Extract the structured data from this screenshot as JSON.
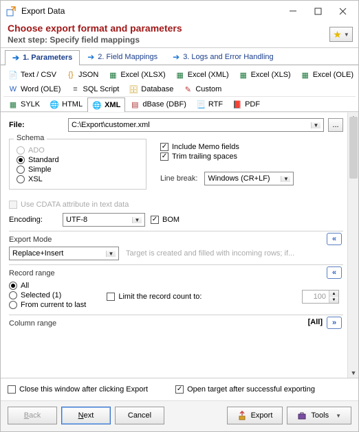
{
  "window": {
    "title": "Export Data"
  },
  "header": {
    "heading": "Choose export format and parameters",
    "sub": "Next step: Specify field mappings"
  },
  "wizard_tabs": {
    "t1": "1. Parameters",
    "t2": "2. Field Mappings",
    "t3": "3. Logs and Error Handling"
  },
  "formats": {
    "text": "Text / CSV",
    "json": "JSON",
    "xlsx": "Excel (XLSX)",
    "xml_xl": "Excel (XML)",
    "xls": "Excel (XLS)",
    "ole_xl": "Excel (OLE)",
    "word": "Word (OLE)",
    "sql": "SQL Script",
    "db": "Database",
    "custom": "Custom",
    "sylk": "SYLK",
    "html": "HTML",
    "xml": "XML",
    "dbase": "dBase (DBF)",
    "rtf": "RTF",
    "pdf": "PDF"
  },
  "file": {
    "label": "File:",
    "value": "C:\\Export\\customer.xml",
    "dots": "..."
  },
  "schema": {
    "legend": "Schema",
    "ado": "ADO",
    "standard": "Standard",
    "simple": "Simple",
    "xsl": "XSL"
  },
  "right": {
    "memo": "Include Memo fields",
    "trim": "Trim trailing spaces",
    "lb_label": "Line break:",
    "lb_value": "Windows (CR+LF)"
  },
  "cdata": "Use CDATA attribute in text data",
  "encoding": {
    "label": "Encoding:",
    "value": "UTF-8",
    "bom": "BOM"
  },
  "export_mode": {
    "title": "Export Mode",
    "value": "Replace+Insert",
    "desc": "Target is created and filled with incoming rows; if..."
  },
  "record_range": {
    "title": "Record range",
    "all": "All",
    "selected": "Selected (1)",
    "current": "From current to last",
    "limit_label": "Limit the record count to:",
    "limit_value": "100"
  },
  "column_range": {
    "title": "Column range",
    "all": "[All]"
  },
  "footer": {
    "close_after": "Close this window after clicking Export",
    "open_after": "Open target after successful exporting"
  },
  "buttons": {
    "back_html": "<u>B</u>ack",
    "next_html": "<u>N</u>ext",
    "cancel": "Cancel",
    "export": "Export",
    "tools": "Tools"
  },
  "glyphs": {
    "collapse": "«",
    "expand": "»"
  }
}
